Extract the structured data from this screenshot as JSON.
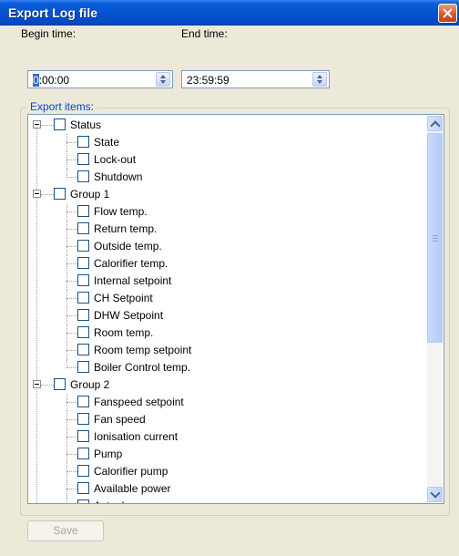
{
  "window": {
    "title": "Export Log file"
  },
  "begin_time": {
    "label": "Begin time:",
    "value_first": "0",
    "value_rest": ":00:00"
  },
  "end_time": {
    "label": "End time:",
    "value": "23:59:59"
  },
  "export_items": {
    "legend": "Export items:",
    "groups": [
      {
        "label": "Status",
        "children": [
          "State",
          "Lock-out",
          "Shutdown"
        ]
      },
      {
        "label": "Group 1",
        "children": [
          "Flow temp.",
          "Return temp.",
          "Outside temp.",
          "Calorifier temp.",
          "Internal setpoint",
          "CH Setpoint",
          "DHW Setpoint",
          "Room temp.",
          "Room temp setpoint",
          "Boiler Control temp."
        ]
      },
      {
        "label": "Group 2",
        "children": [
          "Fanspeed setpoint",
          "Fan speed",
          "Ionisation current",
          "Pump",
          "Calorifier pump",
          "Available power",
          "Actual power"
        ]
      }
    ]
  },
  "actions": {
    "save_label": "Save"
  }
}
